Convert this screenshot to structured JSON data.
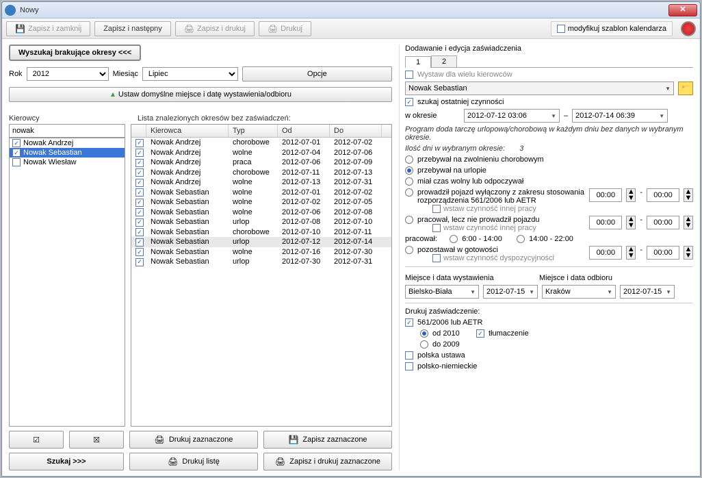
{
  "window": {
    "title": "Nowy"
  },
  "toolbar": {
    "save_close": "Zapisz i zamknij",
    "save_next": "Zapisz i następny",
    "save_print": "Zapisz i drukuj",
    "print": "Drukuj",
    "modify_template": "modyfikuj szablon kalendarza"
  },
  "left": {
    "search_missing": "Wyszukaj brakujące okresy <<<",
    "year_label": "Rok",
    "year_value": "2012",
    "month_label": "Miesiąc",
    "month_value": "Lipiec",
    "options": "Opcje",
    "set_default": "Ustaw domyślne miejsce i datę wystawienia/odbioru",
    "drivers_label": "Kierowcy",
    "found_label": "Lista znalezionych okresów bez zaświadczeń:",
    "filter_value": "nowak",
    "drivers": [
      {
        "name": "Nowak Andrzej",
        "checked": true,
        "selected": false
      },
      {
        "name": "Nowak Sebastian",
        "checked": true,
        "selected": true
      },
      {
        "name": "Nowak Wiesław",
        "checked": false,
        "selected": false
      }
    ],
    "cols": {
      "driver": "Kierowca",
      "type": "Typ",
      "from": "Od",
      "to": "Do"
    },
    "rows": [
      {
        "d": "Nowak Andrzej",
        "t": "chorobowe",
        "f": "2012-07-01",
        "to": "2012-07-02",
        "sel": false
      },
      {
        "d": "Nowak Andrzej",
        "t": "wolne",
        "f": "2012-07-04",
        "to": "2012-07-06",
        "sel": false
      },
      {
        "d": "Nowak Andrzej",
        "t": "praca",
        "f": "2012-07-06",
        "to": "2012-07-09",
        "sel": false
      },
      {
        "d": "Nowak Andrzej",
        "t": "chorobowe",
        "f": "2012-07-11",
        "to": "2012-07-13",
        "sel": false
      },
      {
        "d": "Nowak Andrzej",
        "t": "wolne",
        "f": "2012-07-13",
        "to": "2012-07-31",
        "sel": false
      },
      {
        "d": "Nowak Sebastian",
        "t": "wolne",
        "f": "2012-07-01",
        "to": "2012-07-02",
        "sel": false
      },
      {
        "d": "Nowak Sebastian",
        "t": "wolne",
        "f": "2012-07-02",
        "to": "2012-07-05",
        "sel": false
      },
      {
        "d": "Nowak Sebastian",
        "t": "wolne",
        "f": "2012-07-06",
        "to": "2012-07-08",
        "sel": false
      },
      {
        "d": "Nowak Sebastian",
        "t": "urlop",
        "f": "2012-07-08",
        "to": "2012-07-10",
        "sel": false
      },
      {
        "d": "Nowak Sebastian",
        "t": "chorobowe",
        "f": "2012-07-10",
        "to": "2012-07-11",
        "sel": false
      },
      {
        "d": "Nowak Sebastian",
        "t": "urlop",
        "f": "2012-07-12",
        "to": "2012-07-14",
        "sel": true
      },
      {
        "d": "Nowak Sebastian",
        "t": "wolne",
        "f": "2012-07-16",
        "to": "2012-07-30",
        "sel": false
      },
      {
        "d": "Nowak Sebastian",
        "t": "urlop",
        "f": "2012-07-30",
        "to": "2012-07-31",
        "sel": false
      }
    ],
    "btn_print_sel": "Drukuj zaznaczone",
    "btn_save_sel": "Zapisz zaznaczone",
    "btn_print_list": "Drukuj listę",
    "btn_save_print_sel": "Zapisz i drukuj zaznaczone",
    "btn_search": "Szukaj >>>"
  },
  "right": {
    "title": "Dodawanie i edycja zaświadczenia",
    "tab1": "1",
    "tab2": "2",
    "multi_drivers": "Wystaw dla wielu kierowców",
    "driver_value": "Nowak Sebastian",
    "search_last": "szukaj ostatniej czynności",
    "period_label": "w okresie",
    "period_from": "2012-07-12 03:06",
    "period_to": "2012-07-14 06:39",
    "info": "Program doda tarczę urlopową/chorobową w każdym dniu bez danych w wybranym okresie.",
    "days_label": "Ilość dni w wybranym okresie:",
    "days_value": "3",
    "r_sick": "przebywał na zwolnieniu chorobowym",
    "r_vacation": "przebywał na urlopie",
    "r_free": "miał czas wolny lub odpoczywał",
    "r_vehicle": "prowadził pojazd wyłączony z zakresu stosowania rozporządzenia 561/2006 lub AETR",
    "sub_other": "wstaw czynność innej pracy",
    "r_worked": "pracował, lecz nie prowadził pojazdu",
    "worked_label": "pracował:",
    "worked_r1": "6:00 - 14:00",
    "worked_r2": "14:00 - 22:00",
    "r_ready": "pozostawał w gotowości",
    "sub_dysp": "wstaw czynność dyspozycyjności",
    "time_zero": "00:00",
    "issue_place_label": "Miejsce i data wystawienia",
    "receive_place_label": "Miejsce i data odbioru",
    "issue_place": "Bielsko-Biała",
    "issue_date": "2012-07-15",
    "receive_place": "Kraków",
    "receive_date": "2012-07-15",
    "print_label": "Drukuj zaświadczenie:",
    "chk_561": "561/2006 lub AETR",
    "r_od2010": "od 2010",
    "r_do2009": "do 2009",
    "chk_translate": "tłumaczenie",
    "chk_polska": "polska ustawa",
    "chk_polskoniem": "polsko-niemieckie"
  }
}
